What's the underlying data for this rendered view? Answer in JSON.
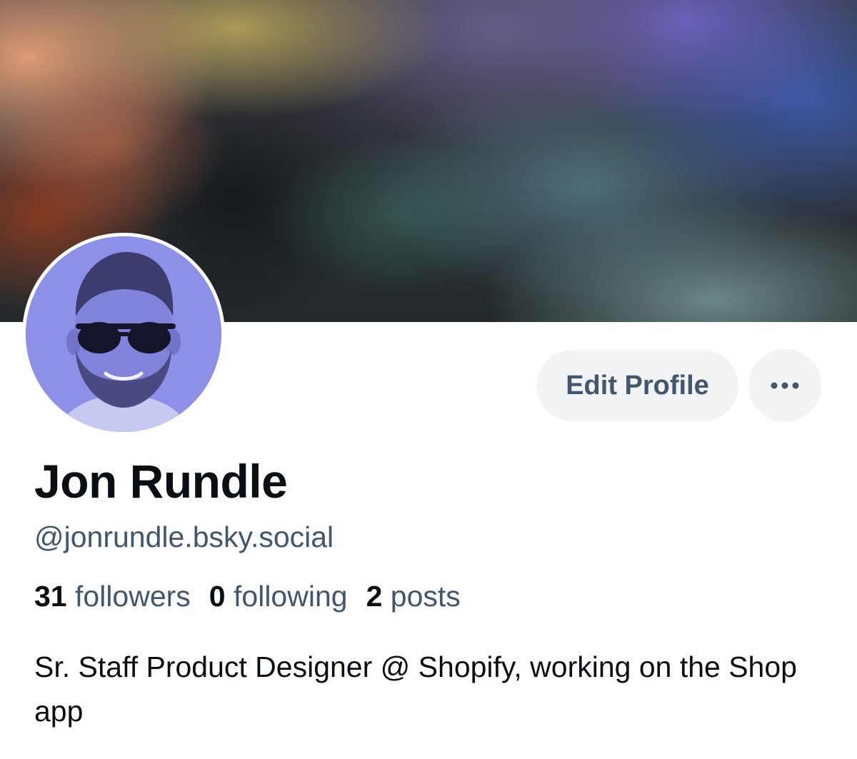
{
  "profile": {
    "display_name": "Jon Rundle",
    "handle": "@jonrundle.bsky.social",
    "bio": "Sr. Staff Product Designer @ Shopify, working on the Shop app"
  },
  "actions": {
    "edit_profile_label": "Edit Profile",
    "more_icon": "ellipsis-icon"
  },
  "stats": {
    "followers_count": "31",
    "followers_label": "followers",
    "following_count": "0",
    "following_label": "following",
    "posts_count": "2",
    "posts_label": "posts"
  },
  "colors": {
    "text_primary": "#0b0f14",
    "text_secondary": "#42576c",
    "button_bg": "#f1f3f5",
    "avatar_tint": "#8e8fe6"
  }
}
